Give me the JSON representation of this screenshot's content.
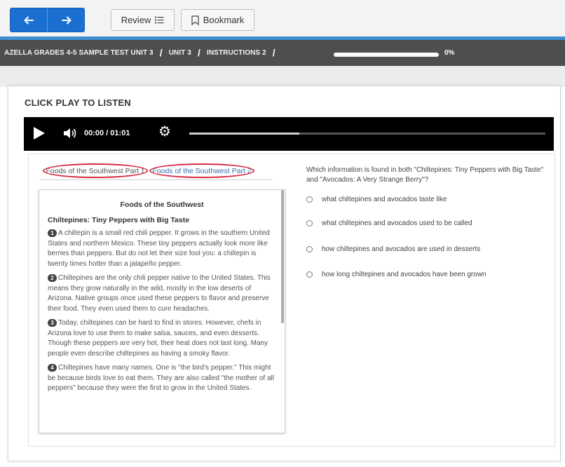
{
  "toolbar": {
    "back_label": "←",
    "forward_label": "→",
    "review_label": "Review",
    "bookmark_label": "Bookmark"
  },
  "breadcrumb": {
    "items": [
      "AZELLA GRADES 4-5 SAMPLE TEST UNIT 3",
      "UNIT 3",
      "INSTRUCTIONS 2"
    ],
    "separator": "/",
    "progress_percent": 0,
    "progress_label": "0%"
  },
  "main": {
    "listen_label": "CLICK PLAY TO LISTEN"
  },
  "player": {
    "time_display": "00:00 / 01:01",
    "seek_fraction": 0.31
  },
  "tabs": [
    {
      "label": "Foods of the Southwest Part 1"
    },
    {
      "label": "Foods of the Southwest Part 2"
    }
  ],
  "passage": {
    "title": "Foods of the Southwest",
    "subtitle": "Chiltepines: Tiny Peppers with Big Taste",
    "paragraphs": [
      {
        "num": "1",
        "text": "A chiltepin is a small red chili pepper. It grows in the southern United States and northern Mexico. These tiny peppers actually look more like berries than peppers. But do not let their size fool you: a chiltepin is twenty times hotter than a jalapeño pepper."
      },
      {
        "num": "2",
        "text": "Chiltepines are the only chili pepper native to the United States. This means they grow naturally in the wild, mostly in the low deserts of Arizona. Native groups once used these peppers to flavor and preserve their food. They even used them to cure headaches."
      },
      {
        "num": "3",
        "text": "Today, chiltepines can be hard to find in stores. However, chefs in Arizona love to use them to make salsa, sauces, and even desserts. Though these peppers are very hot, their heat does not last long. Many people even describe chiltepines as having a smoky flavor."
      },
      {
        "num": "4",
        "text": "Chiltepines have many names. One is \"the bird's pepper.\" This might be because birds love to eat them. They are also called \"the mother of all peppers\" because they were the first to grow in the United States."
      }
    ]
  },
  "question": {
    "prompt": "Which information is found in both \"Chiltepines: Tiny Peppers with Big Taste\" and \"Avocados: A Very Strange Berry\"?",
    "options": [
      "what chiltepines and avocados taste like",
      "what chiltepines and avocados used to be called",
      "how chiltepines and avocados are used in desserts",
      "how long chiltepines and avocados have been grown"
    ]
  },
  "colors": {
    "nav_blue": "#1a6fd0",
    "crumb_bar": "#4e4e4e",
    "accent_line": "#3d8fd1",
    "tab_highlight": "#d8243a"
  }
}
